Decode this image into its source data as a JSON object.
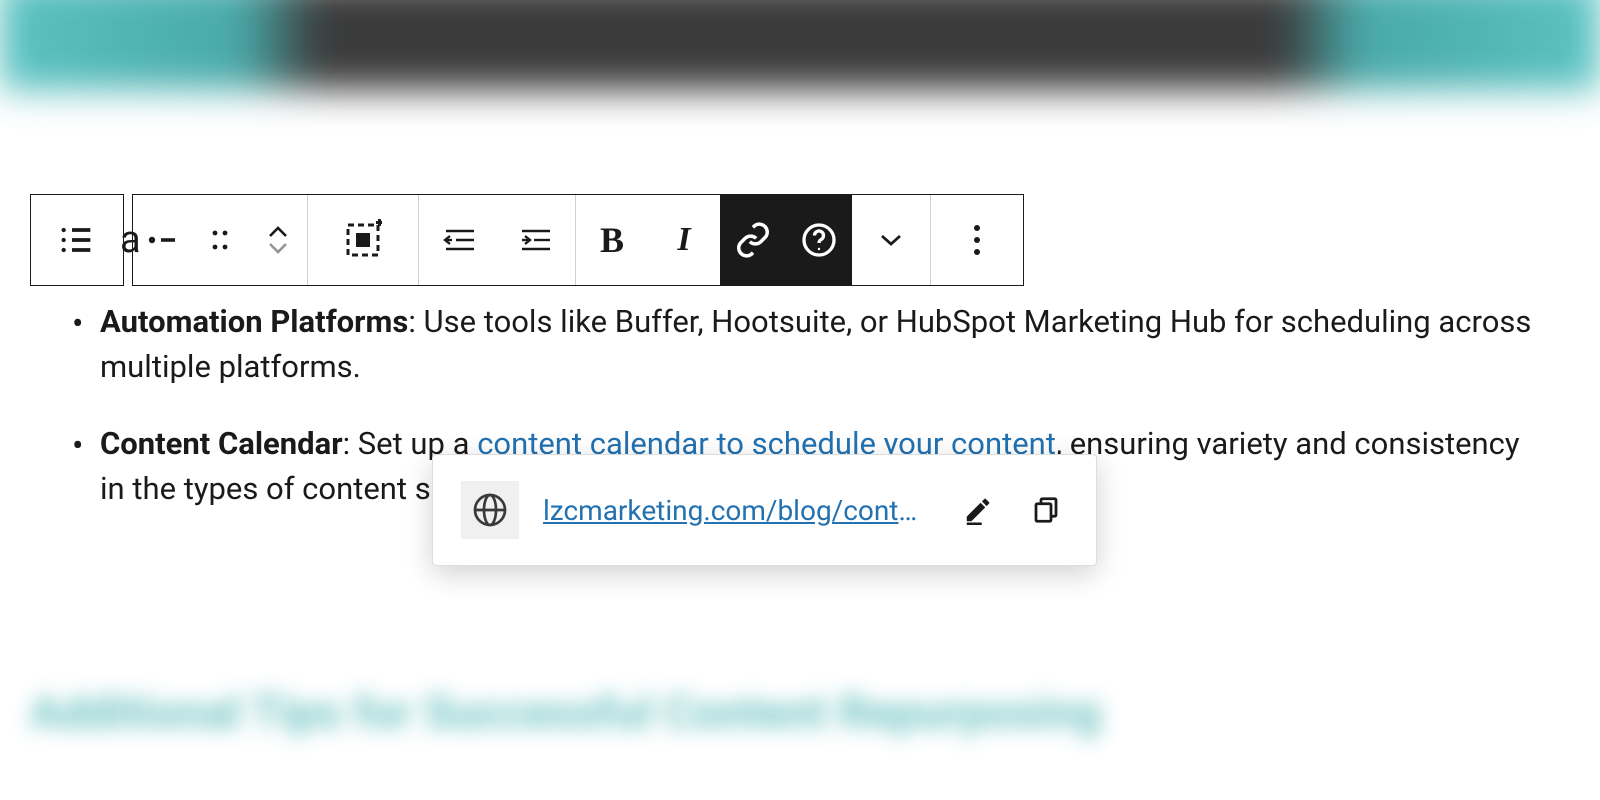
{
  "toolbar": {
    "type_letter": "a"
  },
  "content": {
    "items": [
      {
        "bold": "Automation Platforms",
        "rest": ": Use tools like Buffer, Hootsuite, or HubSpot Marketing Hub for scheduling across multiple platforms."
      },
      {
        "bold": "Content Calendar",
        "pre_link": ": Set up a ",
        "link_text": "content calendar to schedule your content",
        "post_link": ", ensuring variety and consistency in the types of content sha"
      }
    ]
  },
  "popover": {
    "url_display": "lzcmarketing.com/blog/content-p..."
  },
  "blur_heading": "Additional Tips for Successful Content Repurposing"
}
